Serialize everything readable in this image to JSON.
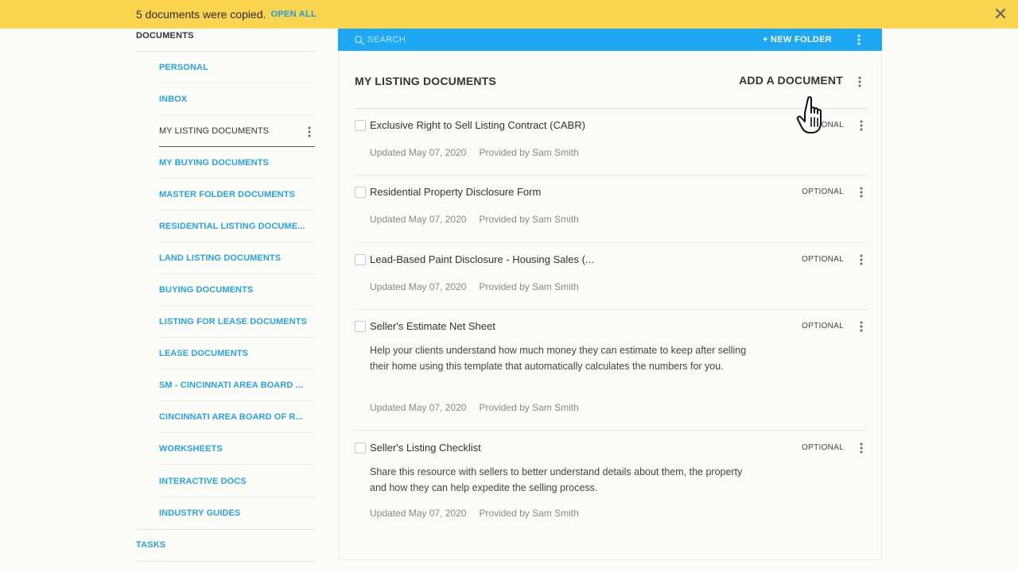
{
  "banner": {
    "message": "5 documents were copied.",
    "link_label": "OPEN ALL",
    "close_icon": "close-icon"
  },
  "sidebar": {
    "documents_heading": "DOCUMENTS",
    "items": [
      {
        "label": "PERSONAL"
      },
      {
        "label": "INBOX"
      },
      {
        "label": "MY LISTING DOCUMENTS",
        "active": true
      },
      {
        "label": "MY BUYING DOCUMENTS"
      },
      {
        "label": "MASTER FOLDER DOCUMENTS"
      },
      {
        "label": "RESIDENTIAL LISTING DOCUME..."
      },
      {
        "label": "LAND LISTING DOCUMENTS"
      },
      {
        "label": "BUYING DOCUMENTS"
      },
      {
        "label": "LISTING FOR LEASE DOCUMENTS"
      },
      {
        "label": "LEASE DOCUMENTS"
      },
      {
        "label": "SM - CINCINNATI AREA BOARD ..."
      },
      {
        "label": "CINCINNATI AREA BOARD OF R..."
      },
      {
        "label": "WORKSHEETS"
      },
      {
        "label": "INTERACTIVE DOCS"
      },
      {
        "label": "INDUSTRY GUIDES"
      }
    ],
    "tasks_heading": "TASKS"
  },
  "toolbar": {
    "search_placeholder": "SEARCH",
    "new_folder_label": "+ NEW FOLDER"
  },
  "main": {
    "title": "MY LISTING DOCUMENTS",
    "add_document_label": "ADD A DOCUMENT",
    "documents": [
      {
        "title": "Exclusive Right to Sell Listing Contract (CABR)",
        "status": "OPTIONAL",
        "description": "",
        "updated": "Updated May 07, 2020",
        "provider": "Provided by Sam Smith"
      },
      {
        "title": "Residential Property Disclosure Form",
        "status": "OPTIONAL",
        "description": "",
        "updated": "Updated May 07, 2020",
        "provider": "Provided by Sam Smith"
      },
      {
        "title": "Lead-Based Paint Disclosure - Housing Sales (...",
        "status": "OPTIONAL",
        "description": "",
        "updated": "Updated May 07, 2020",
        "provider": "Provided by Sam Smith"
      },
      {
        "title": "Seller's Estimate Net Sheet",
        "status": "OPTIONAL",
        "description": "Help your clients understand how much money they can estimate to keep after selling their home using this template that automatically calculates the numbers for you.",
        "updated": "Updated May 07, 2020",
        "provider": "Provided by Sam Smith"
      },
      {
        "title": "Seller's Listing Checklist",
        "status": "OPTIONAL",
        "description": "Share this resource with sellers to better understand details about them, the property and how they can help expedite the selling process.",
        "updated": "Updated May 07, 2020",
        "provider": "Provided by Sam Smith"
      }
    ]
  },
  "colors": {
    "banner": "#fbd54f",
    "toolbar": "#1ea7f2",
    "link": "#2aa3e0"
  }
}
